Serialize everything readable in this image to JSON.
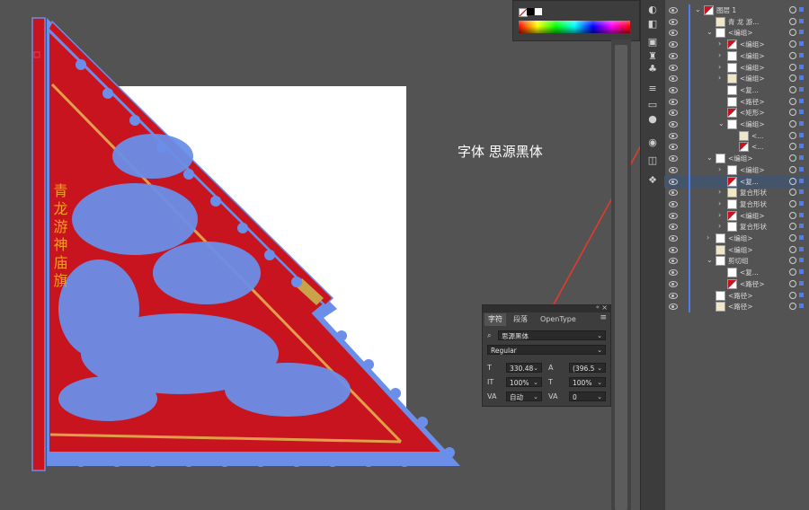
{
  "canvas": {
    "annotation": "字体 思源黑体",
    "banner_vertical_text": "青龙游神庙旗"
  },
  "character_panel": {
    "tabs": [
      "字符",
      "段落",
      "OpenType"
    ],
    "font_family": "思源黑体",
    "font_style": "Regular",
    "font_size": "330.48",
    "leading": "(396.5",
    "vertical_scale": "100%",
    "horizontal_scale": "100%",
    "kerning": "自动",
    "tracking": "0"
  },
  "layers_panel": {
    "rows": [
      {
        "name": "图层 1",
        "indent": 0,
        "arrow": "down"
      },
      {
        "name": "青 龙 游...",
        "indent": 1,
        "arrow": ""
      },
      {
        "name": "<编组>",
        "indent": 1,
        "arrow": "down"
      },
      {
        "name": "<编组>",
        "indent": 2,
        "arrow": "right"
      },
      {
        "name": "<编组>",
        "indent": 2,
        "arrow": "right"
      },
      {
        "name": "<编组>",
        "indent": 2,
        "arrow": "right"
      },
      {
        "name": "<编组>",
        "indent": 2,
        "arrow": "right"
      },
      {
        "name": "<复...",
        "indent": 2,
        "arrow": ""
      },
      {
        "name": "<路径>",
        "indent": 2,
        "arrow": ""
      },
      {
        "name": "<矩形>",
        "indent": 2,
        "arrow": ""
      },
      {
        "name": "<编组>",
        "indent": 2,
        "arrow": "down"
      },
      {
        "name": "<...",
        "indent": 3,
        "arrow": ""
      },
      {
        "name": "<...",
        "indent": 3,
        "arrow": ""
      },
      {
        "name": "<编组>",
        "indent": 1,
        "arrow": "down"
      },
      {
        "name": "<编组>",
        "indent": 2,
        "arrow": "right"
      },
      {
        "name": "<复...",
        "indent": 2,
        "arrow": "",
        "selected": true
      },
      {
        "name": "复合形状",
        "indent": 2,
        "arrow": "right"
      },
      {
        "name": "复合形状",
        "indent": 2,
        "arrow": "right"
      },
      {
        "name": "<编组>",
        "indent": 2,
        "arrow": "right"
      },
      {
        "name": "复合形状",
        "indent": 2,
        "arrow": "right"
      },
      {
        "name": "<编组>",
        "indent": 1,
        "arrow": "right"
      },
      {
        "name": "<编组>",
        "indent": 1,
        "arrow": ""
      },
      {
        "name": "剪切组",
        "indent": 1,
        "arrow": "down"
      },
      {
        "name": "<复...",
        "indent": 2,
        "arrow": ""
      },
      {
        "name": "<路径>",
        "indent": 2,
        "arrow": ""
      },
      {
        "name": "<路径>",
        "indent": 1,
        "arrow": ""
      },
      {
        "name": "<路径>",
        "indent": 1,
        "arrow": ""
      }
    ]
  },
  "colors": {
    "flag_red": "#c8141e",
    "vector_blue": "#6b8fe8",
    "text_orange": "#f0a020",
    "selection_blue": "#4f7df0",
    "annotation_arrow": "#e23b2e"
  }
}
